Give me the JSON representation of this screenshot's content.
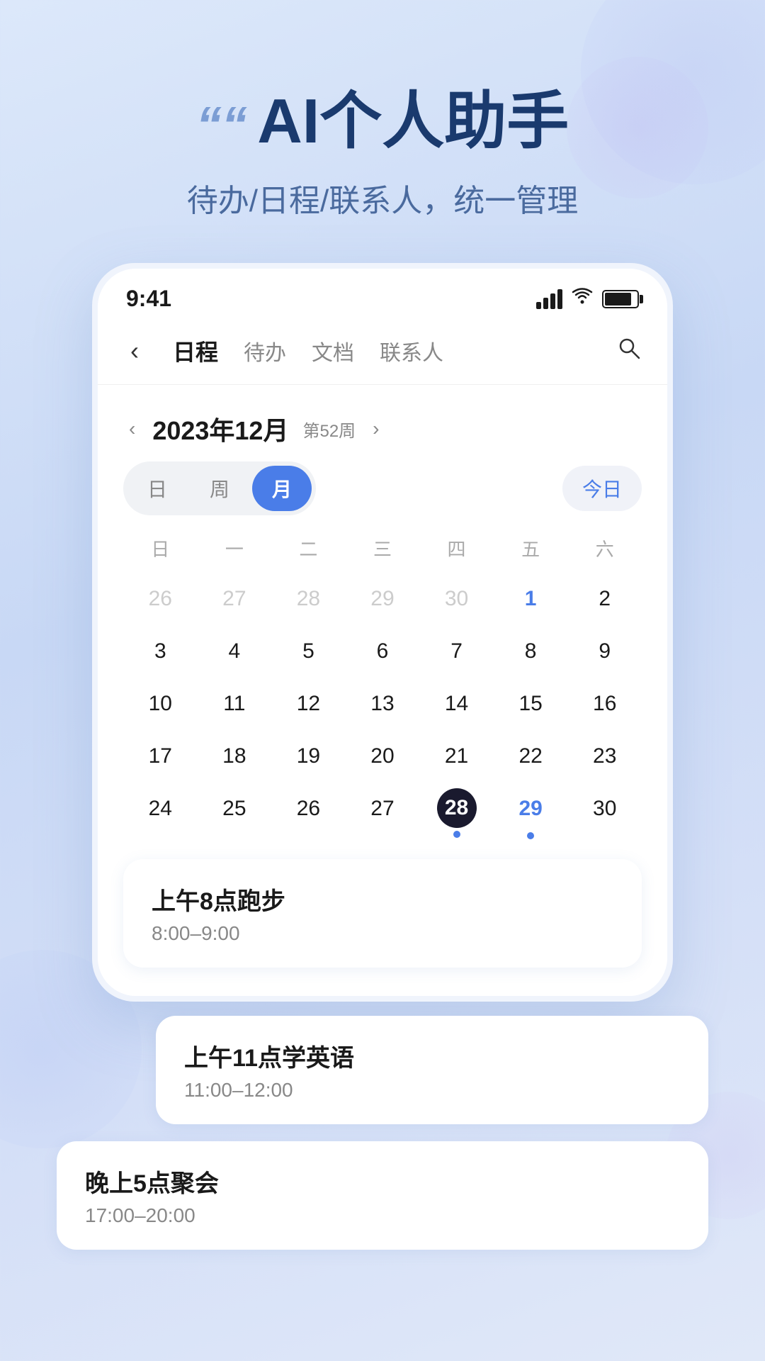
{
  "header": {
    "quote_symbol": "““",
    "title": "AI个人助手",
    "subtitle": "待办/日程/联系人，统一管理"
  },
  "status_bar": {
    "time": "9:41"
  },
  "nav": {
    "back_icon": "‹",
    "tabs": [
      {
        "label": "日程",
        "active": true
      },
      {
        "label": "待办",
        "active": false
      },
      {
        "label": "文档",
        "active": false
      },
      {
        "label": "联系人",
        "active": false
      }
    ],
    "search_icon": "🔍"
  },
  "calendar": {
    "month_title": "2023年12月",
    "week_label": "第52周",
    "prev_icon": "‹",
    "next_icon": "›",
    "view_options": [
      {
        "label": "日",
        "active": false
      },
      {
        "label": "周",
        "active": false
      },
      {
        "label": "月",
        "active": true
      }
    ],
    "today_button": "今日",
    "weekday_headers": [
      "日",
      "一",
      "二",
      "三",
      "四",
      "五",
      "六"
    ],
    "weeks": [
      [
        {
          "day": "26",
          "other": true
        },
        {
          "day": "27",
          "other": true
        },
        {
          "day": "28",
          "other": true
        },
        {
          "day": "29",
          "other": true
        },
        {
          "day": "30",
          "other": true
        },
        {
          "day": "1",
          "highlight": true
        },
        {
          "day": "2"
        }
      ],
      [
        {
          "day": "3"
        },
        {
          "day": "4"
        },
        {
          "day": "5"
        },
        {
          "day": "6"
        },
        {
          "day": "7"
        },
        {
          "day": "8"
        },
        {
          "day": "9"
        }
      ],
      [
        {
          "day": "10"
        },
        {
          "day": "11"
        },
        {
          "day": "12"
        },
        {
          "day": "13"
        },
        {
          "day": "14"
        },
        {
          "day": "15"
        },
        {
          "day": "16"
        }
      ],
      [
        {
          "day": "17"
        },
        {
          "day": "18"
        },
        {
          "day": "19"
        },
        {
          "day": "20"
        },
        {
          "day": "21"
        },
        {
          "day": "22"
        },
        {
          "day": "23"
        }
      ],
      [
        {
          "day": "24"
        },
        {
          "day": "25"
        },
        {
          "day": "26"
        },
        {
          "day": "27"
        },
        {
          "day": "28",
          "today": true,
          "dot": true
        },
        {
          "day": "29",
          "highlight": true,
          "dot": true
        },
        {
          "day": "30"
        }
      ]
    ]
  },
  "events": [
    {
      "title": "上午8点跑步",
      "time": "8:00–9:00",
      "offset": false
    },
    {
      "title": "上午11点学英语",
      "time": "11:00–12:00",
      "offset": true
    },
    {
      "title": "晚上5点聚会",
      "time": "17:00–20:00",
      "offset": false
    }
  ]
}
